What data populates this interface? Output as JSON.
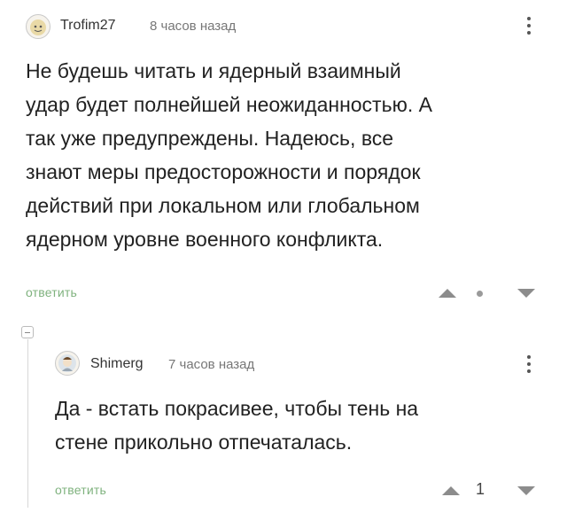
{
  "comments": [
    {
      "author": "Trofim27",
      "time": "8 часов назад",
      "avatar_icon": "user-avatar-icon",
      "text_lines": [
        "Не будешь читать и ядерный взаимный",
        "удар будет полнейшей неожиданностью. А",
        "так уже предупреждены. Надеюсь, все",
        "знают меры предосторожности и порядок",
        "действий при локальном или глобальном",
        "ядерном уровне военного конфликта."
      ],
      "reply_label": "ответить",
      "rating": ""
    },
    {
      "author": "Shimerg",
      "time": "7 часов назад",
      "avatar_icon": "user-avatar-icon",
      "text_lines": [
        "Да - встать покрасивее, чтобы тень на",
        "стене прикольно отпечаталась."
      ],
      "reply_label": "ответить",
      "rating": "1"
    }
  ],
  "colors": {
    "reply_link": "#7fb27e",
    "vote_arrow": "#8c8c8c",
    "thread_line": "#d7d7d7"
  }
}
